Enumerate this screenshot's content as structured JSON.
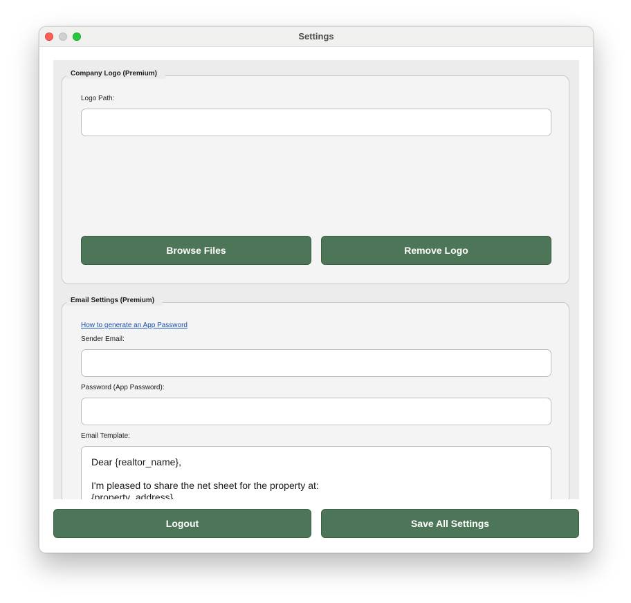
{
  "window": {
    "title": "Settings"
  },
  "logo_group": {
    "legend": "Company Logo (Premium)",
    "path_label": "Logo Path:",
    "path_value": "",
    "browse_label": "Browse Files",
    "remove_label": "Remove Logo"
  },
  "email_group": {
    "legend": "Email Settings (Premium)",
    "help_link": "How to generate an App Password",
    "sender_label": "Sender Email:",
    "sender_value": "",
    "password_label": "Password (App Password):",
    "password_value": "",
    "template_label": "Email Template:",
    "template_lines": [
      "Dear {realtor_name},",
      "",
      "I'm pleased to share the net sheet for the property at:",
      "{property_address}"
    ]
  },
  "footer": {
    "logout_label": "Logout",
    "save_label": "Save All Settings"
  },
  "colors": {
    "button_green": "#4d7557",
    "link_blue": "#1a4fb0"
  }
}
